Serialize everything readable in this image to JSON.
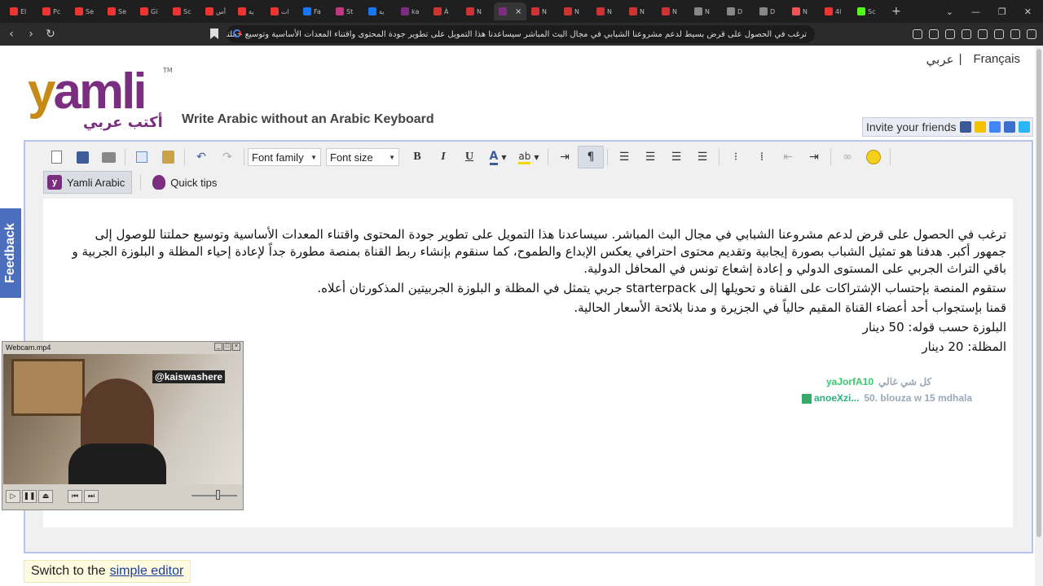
{
  "browser": {
    "tabs": [
      {
        "label": "El",
        "color": "#e33"
      },
      {
        "label": "Pc",
        "color": "#e33"
      },
      {
        "label": "Se",
        "color": "#e33"
      },
      {
        "label": "Se",
        "color": "#e33"
      },
      {
        "label": "Gi",
        "color": "#e33"
      },
      {
        "label": "Sc",
        "color": "#e33"
      },
      {
        "label": "أس",
        "color": "#e33"
      },
      {
        "label": "ية",
        "color": "#e33"
      },
      {
        "label": "ات",
        "color": "#e33"
      },
      {
        "label": "Fa",
        "color": "#1877f2"
      },
      {
        "label": "St",
        "color": "#c13584"
      },
      {
        "label": "ية",
        "color": "#1877f2"
      },
      {
        "label": "ka",
        "color": "#7b2d7f"
      },
      {
        "label": "À",
        "color": "#c33"
      },
      {
        "label": "N",
        "color": "#c33"
      },
      {
        "label": "",
        "color": "#7b2d7f",
        "active": true
      },
      {
        "label": "N",
        "color": "#c33"
      },
      {
        "label": "N",
        "color": "#c33"
      },
      {
        "label": "N",
        "color": "#c33"
      },
      {
        "label": "N",
        "color": "#c33"
      },
      {
        "label": "N",
        "color": "#c33"
      },
      {
        "label": "N",
        "color": "#888"
      },
      {
        "label": "D",
        "color": "#888"
      },
      {
        "label": "D",
        "color": "#888"
      },
      {
        "label": "N",
        "color": "#e55"
      },
      {
        "label": "4l",
        "color": "#e33"
      },
      {
        "label": "Sc",
        "color": "#53fc18"
      }
    ],
    "new_tab": "+",
    "url": "ترغب في الحصول على قرض بسيط لدعم مشروعنا الشبابي في مجال البث المباشر سيساعدنا هذا التمويل على تطوير جودة المحتوى واقتناء المعدات الأساسية وتوسيع حملتنا للوص..."
  },
  "header": {
    "lang_arabic": "عربي",
    "lang_sep": "|",
    "lang_french": "Français",
    "logo_word_y": "y",
    "logo_word_rest": "amli",
    "logo_tm": "TM",
    "logo_arabic": "أكتب عربي",
    "tagline": "Write Arabic without an Arabic Keyboard",
    "invite": "Invite your friends"
  },
  "toolbar": {
    "font_family": "Font family",
    "font_size": "Font size",
    "bold": "B",
    "italic": "I",
    "underline": "U",
    "font_color": "A",
    "highlight": "ab"
  },
  "modes": {
    "yamli_arabic": "Yamli Arabic",
    "quick_tips": "Quick tips"
  },
  "editor": {
    "paragraphs": [
      "ترغب في الحصول على قرض لدعم مشروعنا الشبابي في مجال البث المباشر. سيساعدنا هذا التمويل على تطوير جودة المحتوى واقتناء المعدات الأساسية وتوسيع حملتنا للوصول إلى جمهور أكبر. هدفنا هو تمثيل الشباب بصورة إيجابية وتقديم محتوى احترافي يعكس الإبداع والطموح، كما سنقوم بإنشاء ربط القناة بمنصة مطورة جداً لإعادة إحياء المظلة و البلوزة الجربية و باقي التراث الجربي على المستوى الدولي و إعادة إشعاع تونس في المحافل الدولية.",
      "ستقوم المنصة بإحتساب الإشتراكات على القناة و تحويلها إلى starterpack جربي يتمثل في المظلة و البلوزة الجربيتين المذكورتان أعلاه.",
      "قمنا بإستجواب أحد أعضاء القناة المقيم حالياً في الجزيرة و مدنا بلائحة الأسعار الحالية.",
      "البلوزة حسب قوله: 50 دينار",
      "المظلة: 20 دينار"
    ]
  },
  "chat": {
    "user1": "yaJorfA10",
    "msg1": "كل شي غالي",
    "user2": "anoeXzi...",
    "msg2": "50. blouza w 15 mdhala"
  },
  "feedback": "Feedback",
  "switch": {
    "prefix": "Switch to the",
    "link": "simple editor"
  },
  "webcam": {
    "title": "Webcam.mp4",
    "handle": "@kaiswashere"
  }
}
